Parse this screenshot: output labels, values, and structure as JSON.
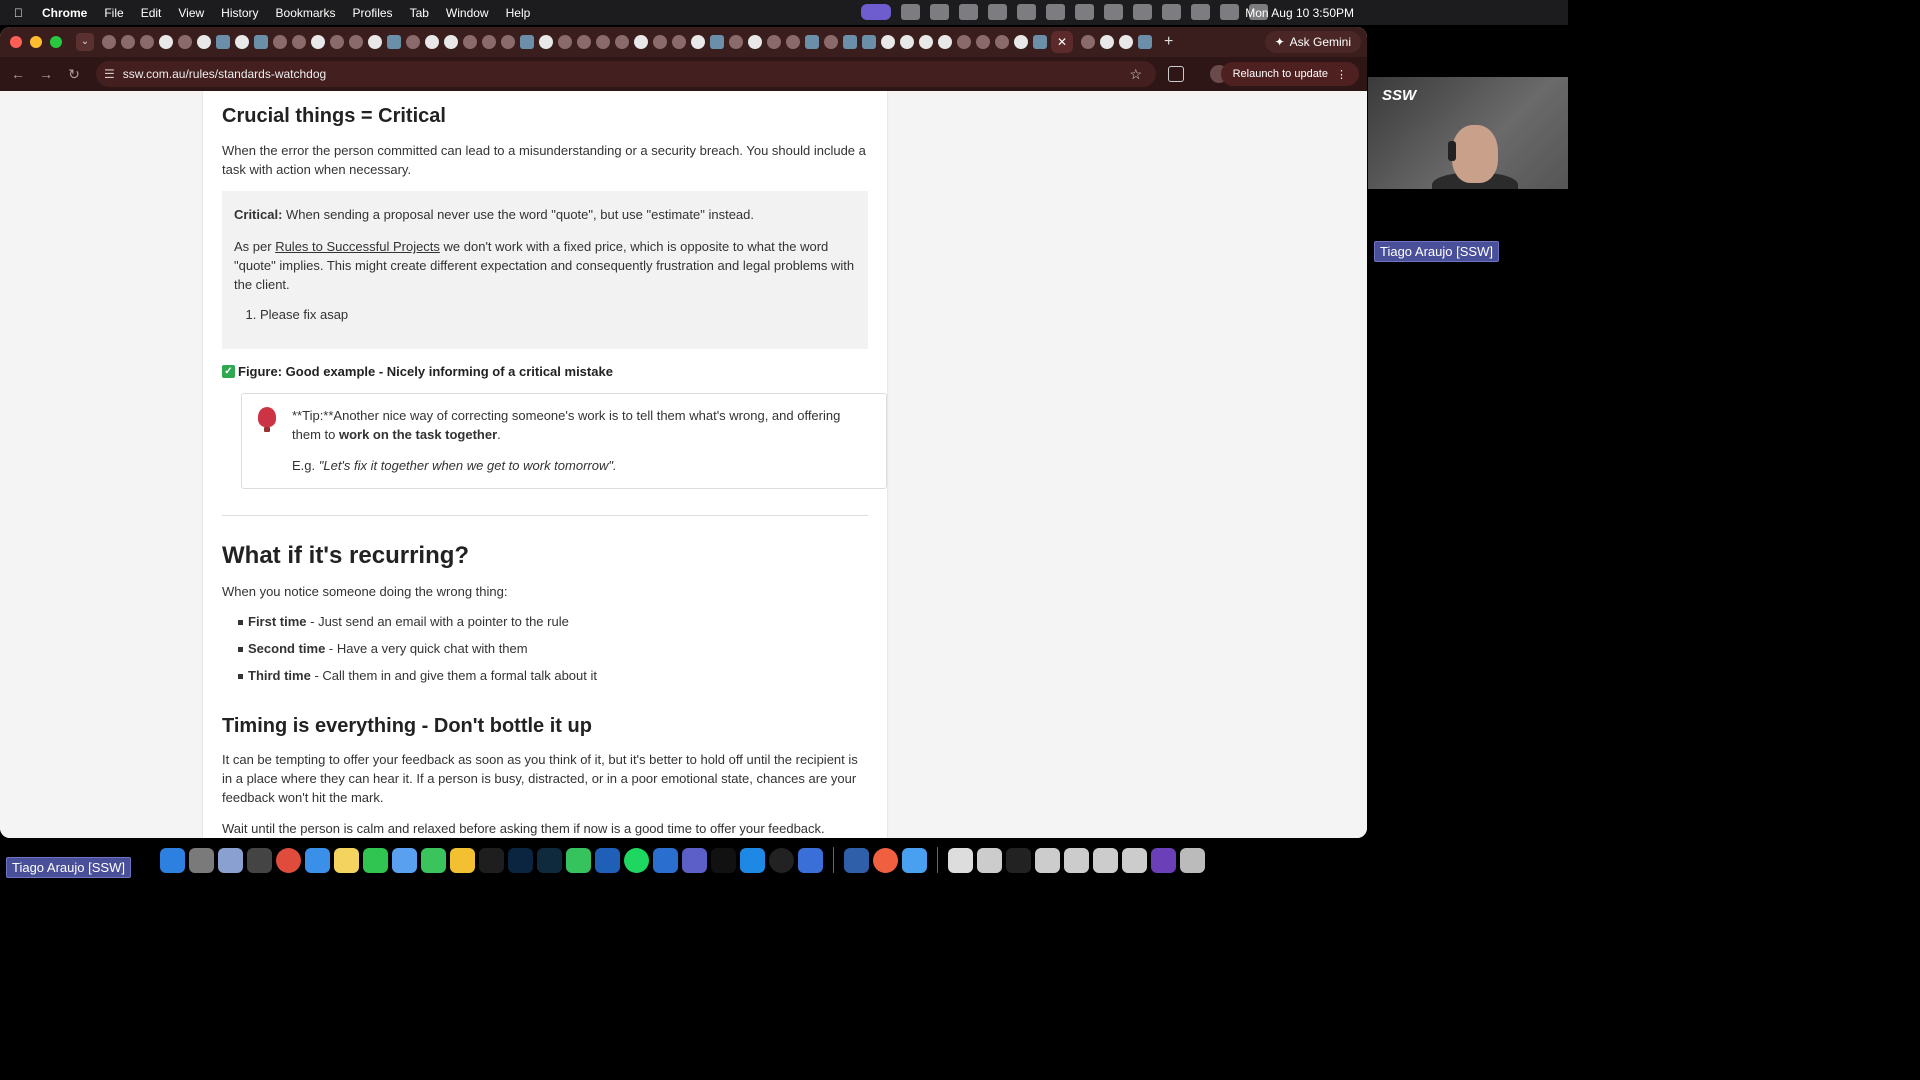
{
  "menubar": {
    "app": "Chrome",
    "items": [
      "File",
      "Edit",
      "View",
      "History",
      "Bookmarks",
      "Profiles",
      "Tab",
      "Window",
      "Help"
    ],
    "clock": "Mon Aug 10  3:50PM"
  },
  "browser": {
    "ask_gemini": "Ask Gemini",
    "url": "ssw.com.au/rules/standards-watchdog",
    "relaunch": "Relaunch to update"
  },
  "article": {
    "h_critical": "Crucial things = Critical",
    "p_critical": "When the error the person committed can lead to a misunderstanding or a security breach. You should include a task with action when necessary.",
    "box": {
      "label": "Critical:",
      "line1": "When sending a proposal never use the word \"quote\", but use \"estimate\" instead.",
      "p2_before": "As per ",
      "p2_link": "Rules to Successful Projects",
      "p2_after": " we don't work with a fixed price, which is opposite to what the word \"quote\" implies. This might create different expectation and consequently frustration and legal problems with the client.",
      "list_item": "Please fix asap"
    },
    "figure": "Figure: Good example - Nicely informing of a critical mistake",
    "tip": {
      "text_before": "**Tip:**Another nice way of correcting someone's work is to tell them what's wrong, and offering them to ",
      "bold": "work on the task together",
      "text_after": ".",
      "eg": "E.g. ",
      "eg_quote": "\"Let's fix it together when we get to work tomorrow\"."
    },
    "h_recurring": "What if it's recurring?",
    "p_recurring": "When you notice someone doing the wrong thing:",
    "list": [
      {
        "bold": "First time",
        "text": " - Just send an email with a pointer to the rule"
      },
      {
        "bold": "Second time",
        "text": " - Have a very quick chat with them"
      },
      {
        "bold": "Third time",
        "text": " - Call them in and give them a formal talk about it"
      }
    ],
    "h_timing": "Timing is everything - Don't bottle it up",
    "p_timing": "It can be tempting to offer your feedback as soon as you think of it, but it's better to hold off until the recipient is in a place where they can hear it. If a person is busy, distracted, or in a poor emotional state, chances are your feedback won't hit the mark.",
    "p_wait": "Wait until the person is calm and relaxed before asking them if now is a good time to offer your feedback."
  },
  "webcam": {
    "logo": "SSW",
    "name": "Tiago Araujo [SSW]"
  },
  "bottom_name": "Tiago Araujo [SSW]",
  "icons": {
    "apple": "apple-icon",
    "star": "bookmark-star-icon",
    "bulb": "lightbulb-icon",
    "check": "check-icon"
  }
}
